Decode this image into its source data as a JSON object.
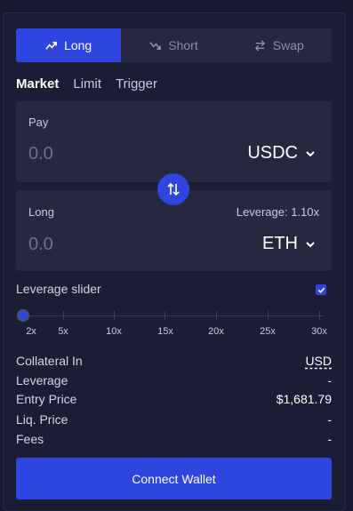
{
  "tabs": [
    {
      "label": "Long",
      "icon": "trend-up-icon",
      "active": true
    },
    {
      "label": "Short",
      "icon": "trend-down-icon",
      "active": false
    },
    {
      "label": "Swap",
      "icon": "swap-arrows-icon",
      "active": false
    }
  ],
  "order_types": [
    "Market",
    "Limit",
    "Trigger"
  ],
  "pay": {
    "label": "Pay",
    "placeholder": "0.0",
    "token": "USDC"
  },
  "long": {
    "label": "Long",
    "placeholder": "0.0",
    "token": "ETH",
    "leverage_text": "Leverage: 1.10x"
  },
  "leverage_slider": {
    "label": "Leverage slider",
    "checked": true,
    "marks": [
      "2x",
      "5x",
      "10x",
      "15x",
      "20x",
      "25x",
      "30x"
    ],
    "value": 1.1
  },
  "info": {
    "collateral_in": {
      "label": "Collateral In",
      "value": "USD"
    },
    "leverage": {
      "label": "Leverage",
      "value": "-"
    },
    "entry_price": {
      "label": "Entry Price",
      "value": "$1,681.79"
    },
    "liq_price": {
      "label": "Liq. Price",
      "value": "-"
    },
    "fees": {
      "label": "Fees",
      "value": "-"
    }
  },
  "connect_button": "Connect Wallet",
  "colors": {
    "accent": "#2e45e0",
    "background": "#16182e",
    "panel": "#1b1d34",
    "field": "#25283f"
  }
}
